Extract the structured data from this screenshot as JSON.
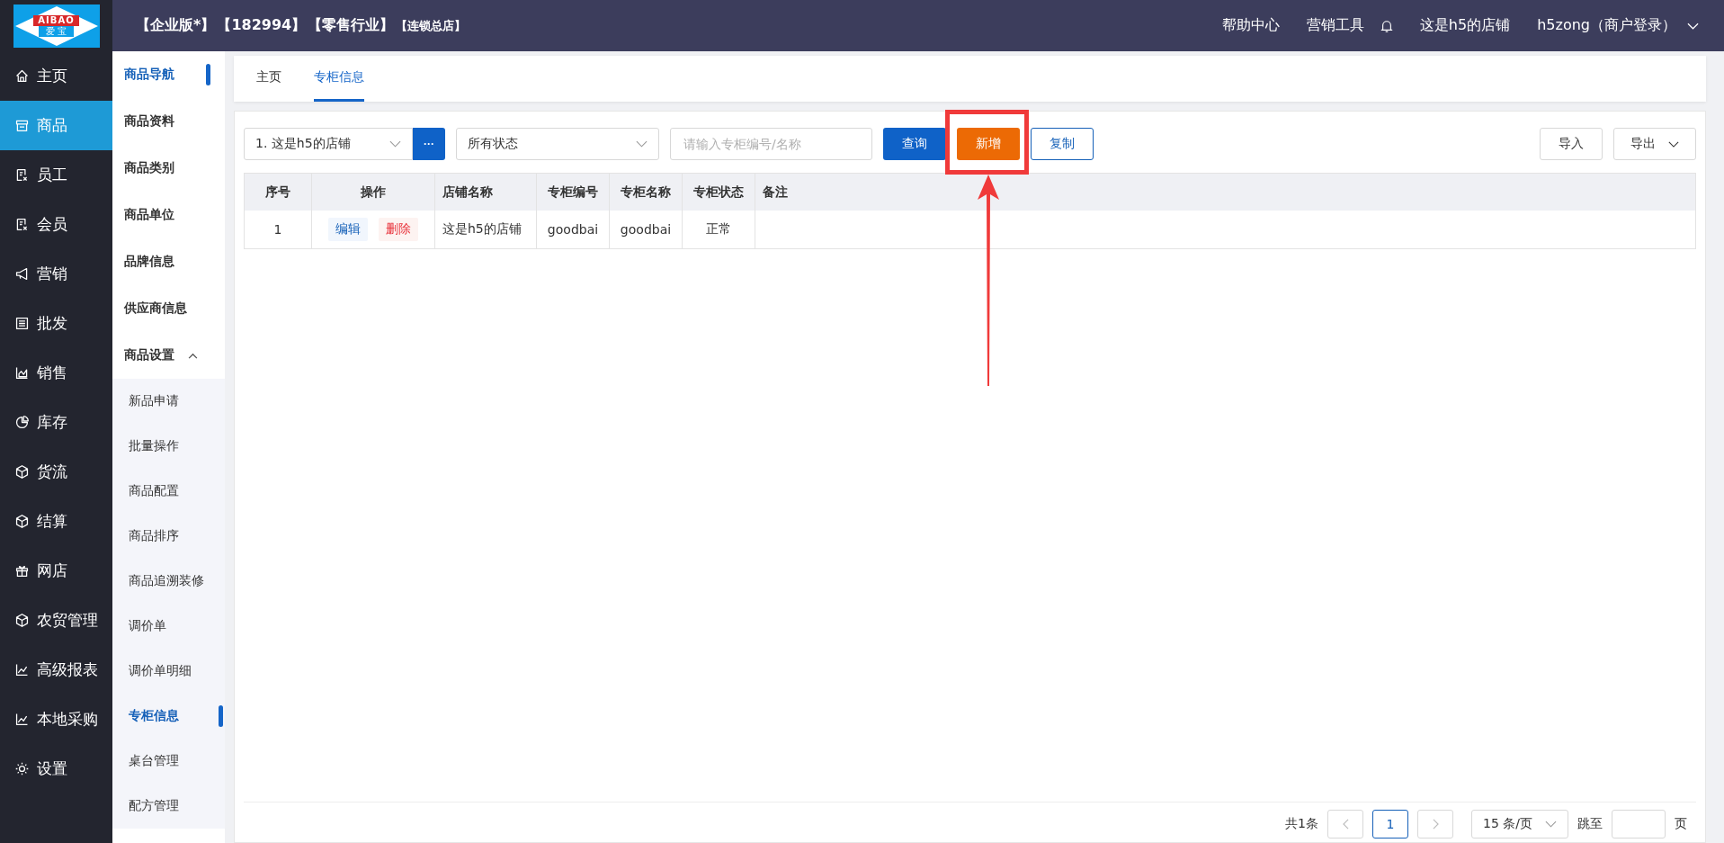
{
  "header": {
    "logo_text": "AIBAO",
    "logo_subtext": "爱 宝",
    "edition": "【企业版*】",
    "account_id": "【182994】",
    "industry": "【零售行业】",
    "store_type": "【连锁总店】",
    "links": [
      "帮助中心",
      "营销工具"
    ],
    "store_name": "这是h5的店铺",
    "user": "h5zong（商户登录）"
  },
  "main_nav": [
    {
      "label": "主页",
      "selected": false
    },
    {
      "label": "商品",
      "selected": true
    },
    {
      "label": "员工",
      "selected": false
    },
    {
      "label": "会员",
      "selected": false
    },
    {
      "label": "营销",
      "selected": false
    },
    {
      "label": "批发",
      "selected": false
    },
    {
      "label": "销售",
      "selected": false
    },
    {
      "label": "库存",
      "selected": false
    },
    {
      "label": "货流",
      "selected": false
    },
    {
      "label": "结算",
      "selected": false
    },
    {
      "label": "网店",
      "selected": false
    },
    {
      "label": "农贸管理",
      "selected": false
    },
    {
      "label": "高级报表",
      "selected": false
    },
    {
      "label": "本地采购",
      "selected": false
    },
    {
      "label": "设置",
      "selected": false
    }
  ],
  "sub_nav": [
    {
      "label": "商品导航",
      "selected": true
    },
    {
      "label": "商品资料",
      "selected": false
    },
    {
      "label": "商品类别",
      "selected": false
    },
    {
      "label": "商品单位",
      "selected": false
    },
    {
      "label": "品牌信息",
      "selected": false
    },
    {
      "label": "供应商信息",
      "selected": false
    },
    {
      "label": "商品设置",
      "selected": false,
      "expanded": true,
      "children": [
        {
          "label": "新品申请",
          "selected": false
        },
        {
          "label": "批量操作",
          "selected": false
        },
        {
          "label": "商品配置",
          "selected": false
        },
        {
          "label": "商品排序",
          "selected": false
        },
        {
          "label": "商品追溯装修",
          "selected": false
        },
        {
          "label": "调价单",
          "selected": false
        },
        {
          "label": "调价单明细",
          "selected": false
        },
        {
          "label": "专柜信息",
          "selected": true
        },
        {
          "label": "桌台管理",
          "selected": false
        },
        {
          "label": "配方管理",
          "selected": false
        }
      ]
    }
  ],
  "tabs": [
    {
      "label": "主页",
      "selected": false
    },
    {
      "label": "专柜信息",
      "selected": true
    }
  ],
  "toolbar": {
    "store_select": "1. 这是h5的店铺",
    "more_button": "···",
    "status_select": "所有状态",
    "search": {
      "placeholder": "请输入专柜编号/名称"
    },
    "buttons": [
      {
        "label": "查询",
        "kind": "primary"
      },
      {
        "label": "新增",
        "kind": "accent"
      },
      {
        "label": "复制",
        "kind": "outline"
      }
    ],
    "import": "导入",
    "export": "导出"
  },
  "table": {
    "columns": [
      "序号",
      "操作",
      "店铺名称",
      "专柜编号",
      "专柜名称",
      "专柜状态",
      "备注"
    ],
    "rows": [
      {
        "index": "1",
        "actions": [
          {
            "label": "编辑",
            "kind": "edit"
          },
          {
            "label": "删除",
            "kind": "delete"
          }
        ],
        "store": "这是h5的店铺",
        "code": "goodbai",
        "name": "goodbai",
        "status": "正常"
      }
    ]
  },
  "pagination": {
    "total": "共1条",
    "page": "1",
    "page_size": "15 条/页",
    "jump_label": "跳至",
    "page_unit": "页"
  }
}
